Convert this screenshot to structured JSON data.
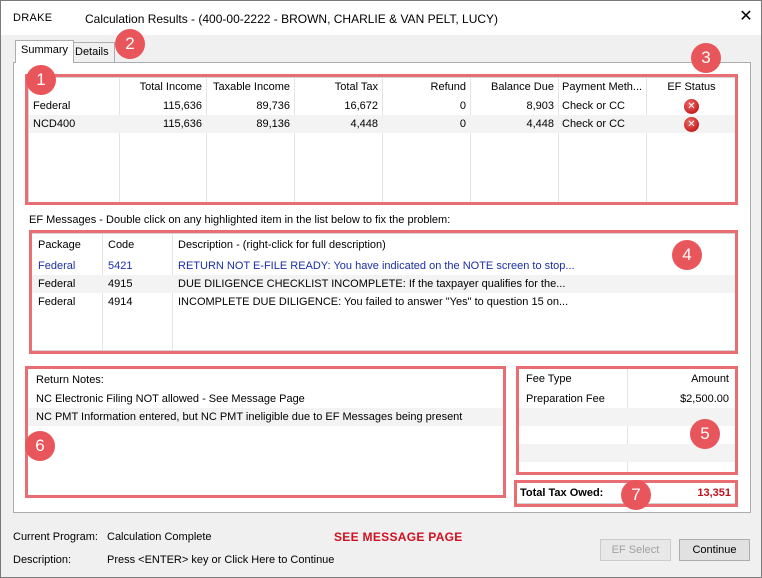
{
  "window": {
    "logo": "DRAKE",
    "title": "Calculation Results - (400-00-2222 - BROWN, CHARLIE & VAN PELT, LUCY)",
    "close_glyph": "✕"
  },
  "tabs": [
    {
      "label": "Summary",
      "active": true
    },
    {
      "label": "Details",
      "active": false
    }
  ],
  "badges": [
    "1",
    "2",
    "3",
    "4",
    "5",
    "6",
    "7"
  ],
  "summary": {
    "columns": [
      "",
      "Total Income",
      "Taxable Income",
      "Total Tax",
      "Refund",
      "Balance Due",
      "Payment Meth...",
      "EF Status"
    ],
    "rows": [
      {
        "package": "Federal",
        "total_income": "115,636",
        "taxable_income": "89,736",
        "total_tax": "16,672",
        "refund": "0",
        "balance_due": "8,903",
        "payment_method": "Check or CC",
        "ef_status": "error-icon"
      },
      {
        "package": "NCD400",
        "total_income": "115,636",
        "taxable_income": "89,136",
        "total_tax": "4,448",
        "refund": "0",
        "balance_due": "4,448",
        "payment_method": "Check or CC",
        "ef_status": "error-icon"
      }
    ]
  },
  "ef_messages": {
    "caption": "EF Messages - Double click on any highlighted item in the list below to fix the problem:",
    "columns": [
      "Package",
      "Code",
      "Description - (right-click for full description)"
    ],
    "rows": [
      {
        "package": "Federal",
        "code": "5421",
        "description": "RETURN NOT E-FILE READY: You have indicated on the NOTE screen to stop...",
        "highlighted": true
      },
      {
        "package": "Federal",
        "code": "4915",
        "description": "DUE DILIGENCE CHECKLIST INCOMPLETE: If the taxpayer qualifies for the...",
        "highlighted": false
      },
      {
        "package": "Federal",
        "code": "4914",
        "description": "INCOMPLETE DUE DILIGENCE: You failed to answer \"Yes\" to question 15 on...",
        "highlighted": false
      }
    ]
  },
  "return_notes": {
    "header": "Return Notes:",
    "items": [
      "NC Electronic Filing NOT allowed - See Message Page",
      "NC PMT Information entered, but NC PMT ineligible due to EF Messages being present"
    ]
  },
  "fees": {
    "columns": [
      "Fee Type",
      "Amount"
    ],
    "rows": [
      {
        "type": "Preparation Fee",
        "amount": "$2,500.00"
      }
    ]
  },
  "total_tax_owed": {
    "label": "Total Tax Owed:",
    "value": "13,351"
  },
  "status": {
    "program_label": "Current Program:",
    "program_value": "Calculation Complete",
    "message": "SEE MESSAGE PAGE",
    "description_label": "Description:",
    "description_value": "Press <ENTER> key or Click Here to Continue"
  },
  "buttons": {
    "ef_select": "EF Select",
    "continue": "Continue"
  },
  "colors": {
    "annotation": "#e8555a",
    "link": "#1c2fa8",
    "alert": "#d01020"
  }
}
